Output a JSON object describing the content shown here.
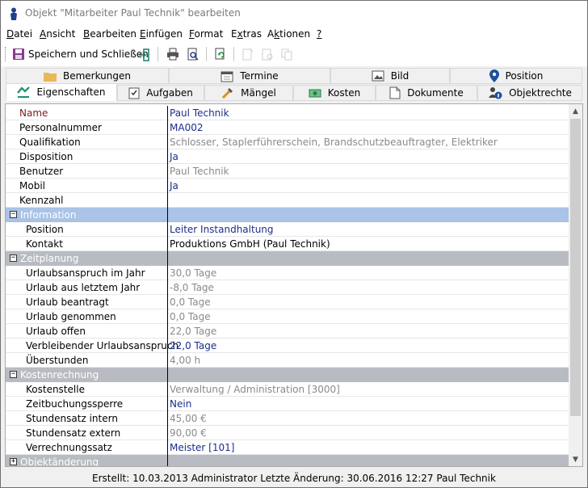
{
  "window": {
    "title": "Objekt \"Mitarbeiter Paul Technik\" bearbeiten"
  },
  "menu": [
    {
      "label": "Datei",
      "u": "D"
    },
    {
      "label": "Ansicht",
      "u": "A"
    },
    {
      "label": "Bearbeiten",
      "u": "B"
    },
    {
      "label": "Einfügen",
      "u": "E"
    },
    {
      "label": "Format",
      "u": "F"
    },
    {
      "label": "Extras",
      "u": "x"
    },
    {
      "label": "Aktionen",
      "u": "k"
    },
    {
      "label": "?",
      "u": "?"
    }
  ],
  "toolbar": {
    "save_close_label": "Speichern und Schließen"
  },
  "tabs_back": [
    "Bemerkungen",
    "Termine",
    "Bild",
    "Position"
  ],
  "tabs_front": [
    "Eigenschaften",
    "Aufgaben",
    "Mängel",
    "Kosten",
    "Dokumente",
    "Objektrechte"
  ],
  "active_tab": "Eigenschaften",
  "properties": [
    {
      "label": "Name",
      "value": "Paul Technik",
      "label_color": "#7a1e1e",
      "value_color": "#1c2d8a"
    },
    {
      "label": "Personalnummer",
      "value": "MA002",
      "value_color": "#1c2d8a"
    },
    {
      "label": "Qualifikation",
      "value": "Schlosser, Staplerführerschein, Brandschutzbeauftragter, Elektriker",
      "value_color": "#8a8a8a"
    },
    {
      "label": "Disposition",
      "value": "Ja",
      "value_color": "#1c2d8a"
    },
    {
      "label": "Benutzer",
      "value": "Paul Technik",
      "value_color": "#8a8a8a"
    },
    {
      "label": "Mobil",
      "value": "Ja",
      "value_color": "#1c2d8a"
    },
    {
      "label": "Kennzahl",
      "value": ""
    }
  ],
  "sections": [
    {
      "title": "Information",
      "expander": "−",
      "rows": [
        {
          "label": "Position",
          "value": "Leiter Instandhaltung",
          "value_color": "#1c2d8a"
        },
        {
          "label": "Kontakt",
          "value": "Produktions GmbH  (Paul Technik)",
          "value_color": "#000000"
        }
      ]
    },
    {
      "title": "Zeitplanung",
      "expander": "−",
      "rows": [
        {
          "label": "Urlaubsanspruch im Jahr",
          "value": "30,0 Tage",
          "value_color": "#8a8a8a"
        },
        {
          "label": "Urlaub aus letztem Jahr",
          "value": "-8,0 Tage",
          "value_color": "#8a8a8a"
        },
        {
          "label": "Urlaub beantragt",
          "value": "0,0 Tage",
          "value_color": "#8a8a8a"
        },
        {
          "label": "Urlaub genommen",
          "value": "0,0 Tage",
          "value_color": "#8a8a8a"
        },
        {
          "label": "Urlaub offen",
          "value": "22,0 Tage",
          "value_color": "#8a8a8a"
        },
        {
          "label": "Verbleibender Urlaubsanspruch",
          "value": "22,0 Tage",
          "value_color": "#1c2d8a"
        },
        {
          "label": "Überstunden",
          "value": "4,00 h",
          "value_color": "#8a8a8a"
        }
      ]
    },
    {
      "title": "Kostenrechnung",
      "expander": "−",
      "rows": [
        {
          "label": "Kostenstelle",
          "value": "Verwaltung / Administration [3000]",
          "value_color": "#8a8a8a"
        },
        {
          "label": "Zeitbuchungssperre",
          "value": "Nein",
          "value_color": "#1c2d8a"
        },
        {
          "label": "Stundensatz intern",
          "value": "45,00 €",
          "value_color": "#8a8a8a"
        },
        {
          "label": "Stundensatz extern",
          "value": "90,00 €",
          "value_color": "#8a8a8a"
        },
        {
          "label": "Verrechnungssatz",
          "value": "Meister [101]",
          "value_color": "#1c2d8a"
        }
      ]
    },
    {
      "title": "Objektänderung",
      "expander": "+",
      "rows": []
    }
  ],
  "status": "Erstellt: 10.03.2013 Administrator  Letzte Änderung: 30.06.2016 12:27 Paul Technik"
}
